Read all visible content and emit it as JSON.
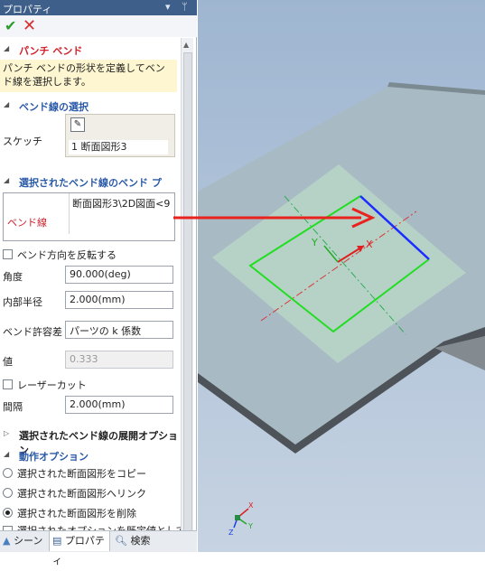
{
  "panel": {
    "title": "プロパティ",
    "title_controls": [
      "▾",
      "ᛘ"
    ],
    "ok_icon": "checkmark-icon",
    "cancel_icon": "close-icon"
  },
  "punch_bend": {
    "header": "パンチ ベンド",
    "description": "パンチ ベンドの形状を定義してベンド線を選択します。"
  },
  "bend_line_selection": {
    "header": "ベンド線の選択",
    "sketch_label": "スケッチ",
    "sketch_item": "1   断面図形3"
  },
  "selected_bend_props": {
    "header": "選択されたベンド線のベンド プロ...",
    "bend_line_label": "ベンド線",
    "bend_line_value": "断面図形3\\2D図面<9"
  },
  "options": {
    "reverse_label": "ベンド方向を反転する",
    "angle_label": "角度",
    "angle_value": "90.000(deg)",
    "inner_radius_label": "内部半径",
    "inner_radius_value": "2.000(mm)",
    "tolerance_label": "ベンド許容差",
    "tolerance_value": "パーツの k 係数",
    "value_label": "値",
    "value_value": "0.333",
    "laser_cut_label": "レーザーカット",
    "interval_label": "間隔",
    "interval_value": "2.000(mm)"
  },
  "unfold_options": {
    "header": "選択されたベンド線の展開オプション"
  },
  "operation_options": {
    "header": "動作オプション",
    "radios": [
      "選択された断面図形をコピー",
      "選択された断面図形へリンク",
      "選択された断面図形を削除",
      "選択されたオプションを既定値として使"
    ],
    "selected_index": 2
  },
  "bottom_tabs": [
    {
      "label": "シーン",
      "icon": "scene-icon"
    },
    {
      "label": "プロパティ",
      "icon": "properties-icon"
    },
    {
      "label": "検索",
      "icon": "search-icon"
    }
  ],
  "colors": {
    "title_bar": "#3e5f8a",
    "required_red": "#d0202a",
    "section_blue": "#2a5aa8",
    "description_bg": "#fdf6d0",
    "sketch_green": "#22dd22",
    "bend_line_blue": "#1a2cff",
    "arrow_red": "#e8231f"
  },
  "viewport": {
    "triad_labels": [
      "X",
      "Y",
      "Z"
    ]
  }
}
